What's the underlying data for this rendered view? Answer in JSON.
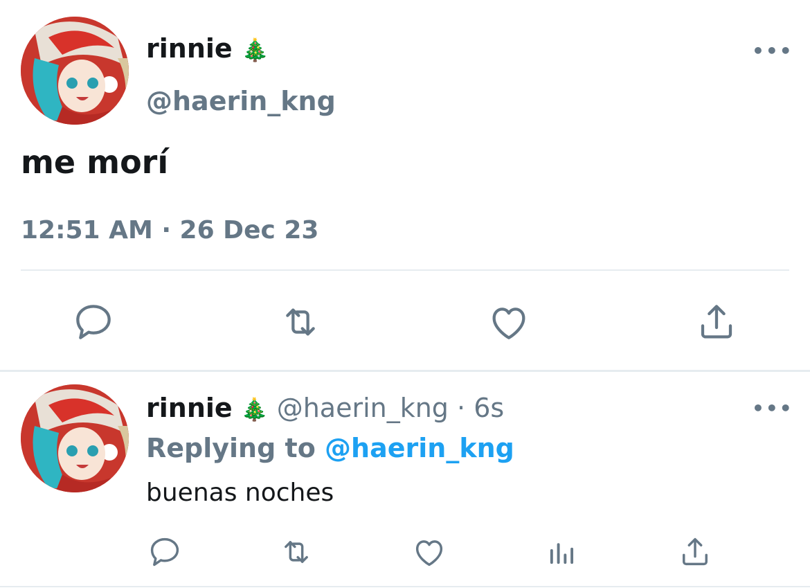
{
  "tweet": {
    "author_name": "rinnie",
    "author_emoji": "🎄",
    "author_handle": "@haerin_kng",
    "text": "me morí",
    "timestamp": "12:51 AM · 26 Dec 23",
    "more_label": "•••",
    "actions": [
      "reply-icon",
      "retweet-icon",
      "like-icon",
      "share-icon"
    ]
  },
  "reply": {
    "author_name": "rinnie",
    "author_emoji": "🎄",
    "author_handle": "@haerin_kng",
    "separator": "·",
    "time": "6s",
    "replying_to_label": "Replying to",
    "replying_to_handle": "@haerin_kng",
    "text": "buenas noches",
    "more_label": "•••",
    "actions": [
      "reply-icon",
      "retweet-icon",
      "like-icon",
      "analytics-icon",
      "share-icon"
    ]
  },
  "colors": {
    "primary_text": "#14171a",
    "secondary_text": "#657786",
    "link": "#1da1f2",
    "divider": "#e6ecf0"
  }
}
